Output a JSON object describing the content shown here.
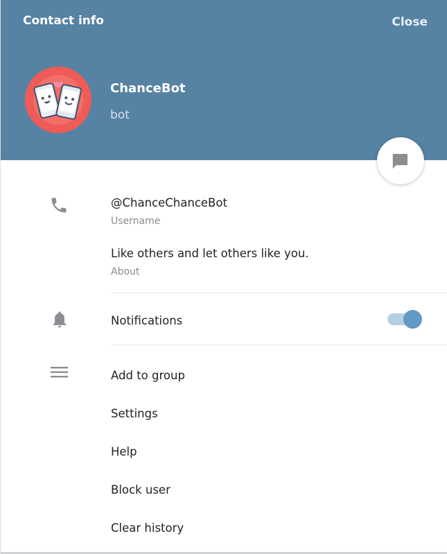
{
  "header": {
    "title": "Contact info",
    "close_label": "Close",
    "background": "#5682a3"
  },
  "profile": {
    "name": "ChanceBot",
    "status": "bot",
    "avatar_color": "#ef5b56"
  },
  "fab": {
    "icon": "message-icon"
  },
  "info": {
    "username": {
      "value": "@ChanceChanceBot",
      "label": "Username",
      "icon": "phone-icon"
    },
    "about": {
      "value": "Like others and let others like you.",
      "label": "About"
    }
  },
  "notifications": {
    "label": "Notifications",
    "icon": "bell-icon",
    "enabled": true
  },
  "menu": {
    "icon": "menu-icon",
    "items": [
      {
        "label": "Add to group"
      },
      {
        "label": "Settings"
      },
      {
        "label": "Help"
      },
      {
        "label": "Block user"
      },
      {
        "label": "Clear history"
      }
    ]
  }
}
